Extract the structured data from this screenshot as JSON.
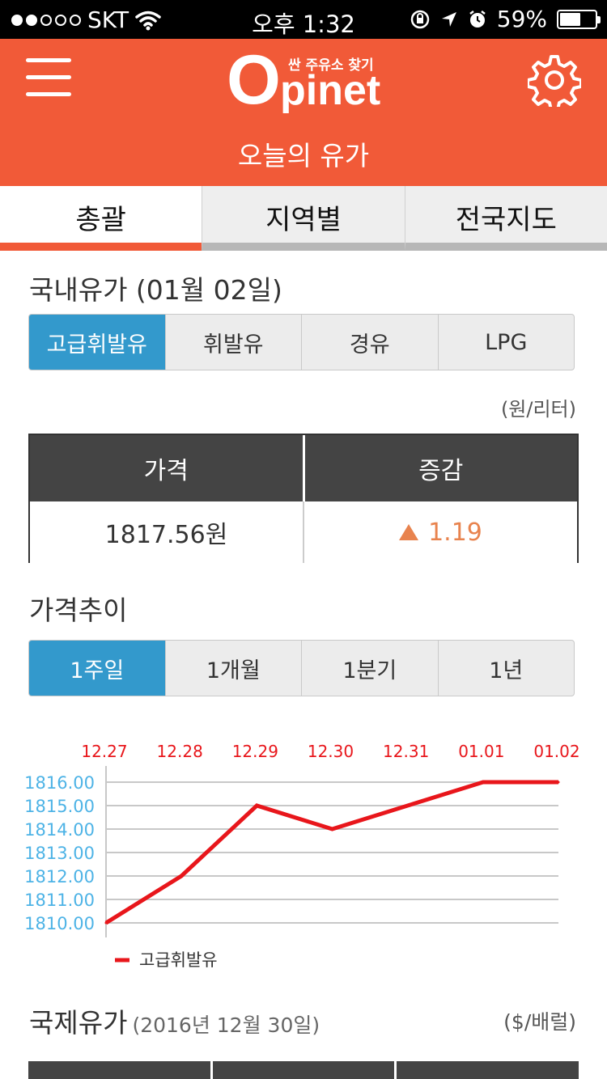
{
  "status_bar": {
    "carrier": "SKT",
    "time": "오후 1:32",
    "battery_percent": "59%",
    "battery_level": 0.59,
    "signal_bars": 2,
    "icons": [
      "wifi-icon",
      "rotation-lock-icon",
      "location-icon",
      "alarm-icon",
      "battery-icon"
    ]
  },
  "header": {
    "logo_o": "O",
    "logo_pinet": "pinet",
    "logo_tagline": "싼 주유소 찾기",
    "title": "오늘의 유가",
    "brand_color": "#f15a38"
  },
  "tabs": [
    {
      "label": "총괄",
      "active": true
    },
    {
      "label": "지역별",
      "active": false
    },
    {
      "label": "전국지도",
      "active": false
    }
  ],
  "domestic": {
    "title": "국내유가 (01월 02일)",
    "fuel_types": [
      "고급휘발유",
      "휘발유",
      "경유",
      "LPG"
    ],
    "selected_fuel": "고급휘발유",
    "unit": "(원/리터)",
    "table": {
      "headers": [
        "가격",
        "증감"
      ],
      "price": "1817.56원",
      "change": "1.19",
      "change_direction": "up",
      "change_color": "#e8834e"
    }
  },
  "trend": {
    "title": "가격추이",
    "periods": [
      "1주일",
      "1개월",
      "1분기",
      "1년"
    ],
    "selected_period": "1주일",
    "accent_color": "#3399cc"
  },
  "chart_data": {
    "type": "line",
    "x": [
      "12.27",
      "12.28",
      "12.29",
      "12.30",
      "12.31",
      "01.01",
      "01.02"
    ],
    "series": [
      {
        "name": "고급휘발유",
        "values": [
          1810.0,
          1812.0,
          1815.0,
          1814.0,
          1815.0,
          1816.0,
          1816.0
        ],
        "color": "#e8161b"
      }
    ],
    "y_ticks": [
      "1816.00",
      "1815.00",
      "1814.00",
      "1813.00",
      "1812.00",
      "1811.00",
      "1810.00"
    ],
    "ylim": [
      1810,
      1816
    ],
    "grid": true,
    "legend": "bottom-left",
    "x_label_color": "#e8161b",
    "y_label_color": "#4db3e6"
  },
  "international": {
    "title": "국제유가",
    "date": "(2016년 12월 30일)",
    "unit": "($/배럴)"
  }
}
